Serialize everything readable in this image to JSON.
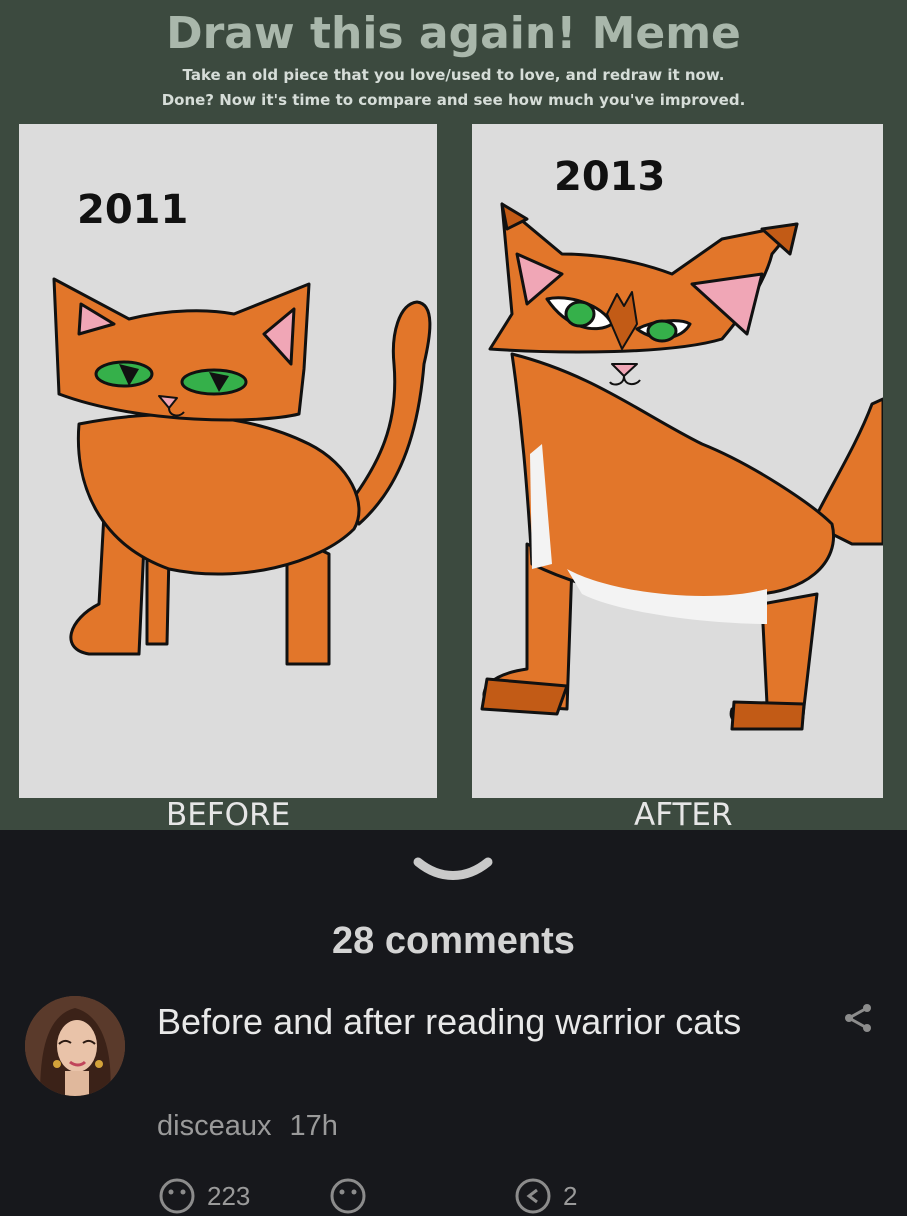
{
  "meme": {
    "title": "Draw this again! Meme",
    "subtitle_line1": "Take an old piece that you love/used to love, and redraw it now.",
    "subtitle_line2": "Done? Now it's time to compare and see how much you've improved.",
    "before_year": "2011",
    "after_year": "2013",
    "before_caption": "BEFORE",
    "after_caption": "AFTER"
  },
  "expand_icon": "chevron-down-icon",
  "comments": {
    "count_label": "28 comments",
    "post_text": "Before and after reading warrior cats",
    "author": "disceaux",
    "time": "17h",
    "upvotes": "223",
    "replies": "2"
  },
  "colors": {
    "meme_bg": "#3c4a3f",
    "panel_bg": "#dcdcdc",
    "cat_orange": "#e2762a",
    "app_bg": "#17181c"
  }
}
